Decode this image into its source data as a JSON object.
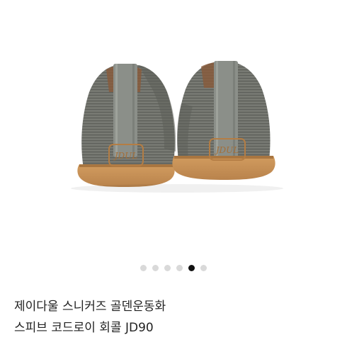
{
  "product": {
    "image": {
      "alt": "gray corduroy sneakers, rear view, gum sole with JDUL logo",
      "upper_color": "#6b6d66",
      "sole_color": "#c8945a",
      "heel_tab_color": "#8b8f89",
      "logo_text": "JDUL"
    },
    "carousel": {
      "count": 6,
      "active_index": 4,
      "active_color": "#111111",
      "inactive_color": "#d9d9d9"
    },
    "title_line1": "제이다울 스니커즈 골덴운동화",
    "title_line2": "스피브 코드로이 회콜 JD90"
  }
}
